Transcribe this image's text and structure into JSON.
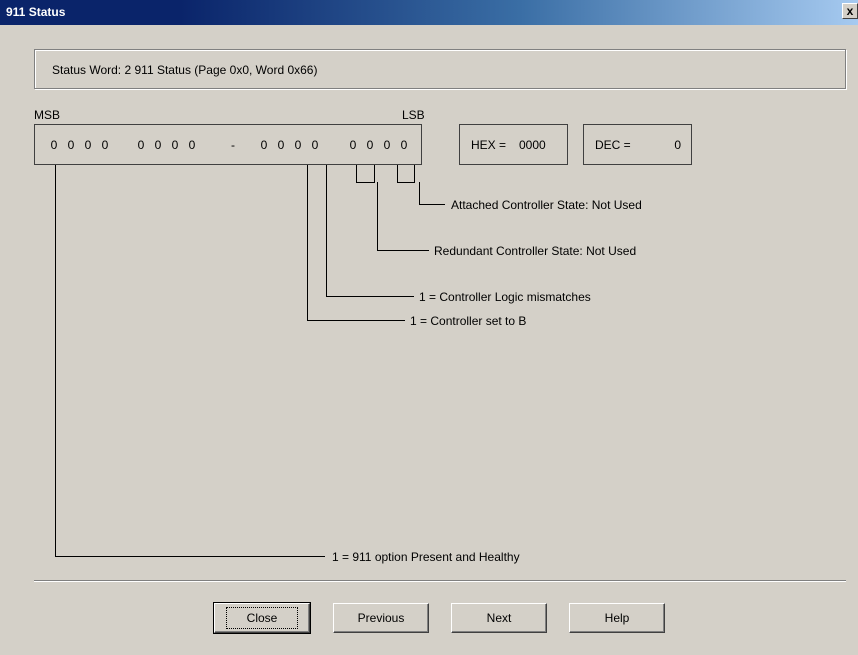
{
  "window": {
    "title": "911 Status",
    "close_glyph": "x"
  },
  "status": {
    "text": "Status Word: 2  911 Status  (Page 0x0, Word 0x66)"
  },
  "bits": {
    "msb_label": "MSB",
    "lsb_label": "LSB",
    "separator": "-",
    "values": [
      "0",
      "0",
      "0",
      "0",
      "0",
      "0",
      "0",
      "0",
      "0",
      "0",
      "0",
      "0",
      "0",
      "0",
      "0",
      "0"
    ]
  },
  "hex": {
    "label": "HEX =",
    "value": "0000"
  },
  "dec": {
    "label": "DEC =",
    "value": "0"
  },
  "descriptions": {
    "attached": "Attached Controller State: Not Used",
    "redundant": "Redundant Controller State: Not Used",
    "logic_mismatch": "1 = Controller Logic mismatches",
    "set_to_b": "1 = Controller set to B",
    "option_present": "1 = 911 option Present and Healthy"
  },
  "buttons": {
    "close": "Close",
    "previous": "Previous",
    "next": "Next",
    "help": "Help"
  }
}
